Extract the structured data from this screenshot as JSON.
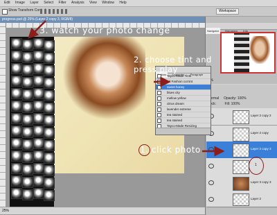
{
  "menubar": {
    "items": [
      "Edit",
      "Image",
      "Layer",
      "Select",
      "Filter",
      "Analysis",
      "View",
      "Window",
      "Help"
    ]
  },
  "options": {
    "show_transform_controls": "Show Transform Controls",
    "workspace": "Workspace"
  },
  "document": {
    "title": "progress.psd @ 25% (Layer 2 copy 3, RGB/8)",
    "status": "25%"
  },
  "actions_panel": {
    "tabs": [
      "Actions",
      "Character",
      "Paragraph"
    ],
    "items": [
      {
        "label": "Tayco-Made Tints",
        "highlighted": false
      },
      {
        "label": "Li'l Fashion cut tint",
        "highlighted": false
      },
      {
        "label": "sweet honey",
        "highlighted": true
      },
      {
        "label": "blues city",
        "highlighted": false
      },
      {
        "label": "mellow yellow",
        "highlighted": false
      },
      {
        "label": "citrus dream",
        "highlighted": false
      },
      {
        "label": "lavender extreme",
        "highlighted": false
      },
      {
        "label": "tea stained",
        "highlighted": false
      },
      {
        "label": "tea stained",
        "highlighted": false
      },
      {
        "label": "Tayco-Made Resizing",
        "highlighted": false
      }
    ]
  },
  "navigator": {
    "tabs": [
      "Navigator",
      "Histogram",
      "Info"
    ],
    "zoom": "25%"
  },
  "layers_panel": {
    "tabs": [
      "Layers",
      "Channels",
      "Paths"
    ],
    "blend_mode": "Normal",
    "opacity_label": "Opacity:",
    "opacity": "100%",
    "lock_label": "Lock:",
    "fill_label": "Fill:",
    "fill": "100%",
    "layers": [
      {
        "name": "Layer 2 copy 2",
        "selected": false
      },
      {
        "name": "Layer 2 copy",
        "selected": false
      },
      {
        "name": "Layer 2 copy 3",
        "selected": true
      },
      {
        "name": "",
        "selected": false
      },
      {
        "name": "Layer 3 copy 3",
        "selected": false
      },
      {
        "name": "Layer 2",
        "selected": false
      }
    ],
    "marker": "1"
  },
  "annotations": {
    "step3": "3. watch your photo change",
    "step2": "2. choose tint and press play",
    "step1_number": "1.",
    "step1_text": "click photo",
    "arrow_color": "#8b1d1d"
  }
}
